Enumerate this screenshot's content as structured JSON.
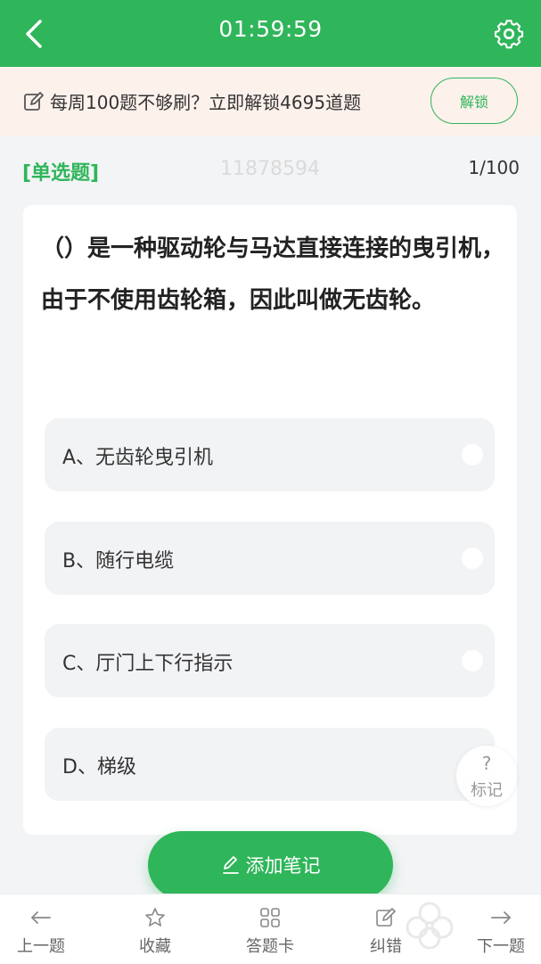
{
  "header": {
    "timer": "01:59:59"
  },
  "banner": {
    "text": "每周100题不够刷？立即解锁4695道题",
    "unlock_label": "解锁"
  },
  "question_meta": {
    "type": "[单选题]",
    "id": "11878594",
    "counter": "1/100"
  },
  "question": {
    "text": "（）是一种驱动轮与马达直接连接的曳引机，由于不使用齿轮箱，因此叫做无齿轮。",
    "options": [
      {
        "label": "A、无齿轮曳引机"
      },
      {
        "label": "B、随行电缆"
      },
      {
        "label": "C、厅门上下行指示"
      },
      {
        "label": "D、梯级"
      }
    ]
  },
  "mark": {
    "symbol": "?",
    "label": "标记"
  },
  "note_button": {
    "label": "添加笔记"
  },
  "bottom_nav": [
    {
      "label": "上一题",
      "icon": "arrow-left-icon"
    },
    {
      "label": "收藏",
      "icon": "star-icon"
    },
    {
      "label": "答题卡",
      "icon": "grid-icon"
    },
    {
      "label": "纠错",
      "icon": "edit-icon"
    },
    {
      "label": "下一题",
      "icon": "arrow-right-icon"
    }
  ],
  "colors": {
    "accent": "#2fb55a",
    "banner_bg": "#fdf1ec",
    "page_bg": "#f3f4f6"
  }
}
